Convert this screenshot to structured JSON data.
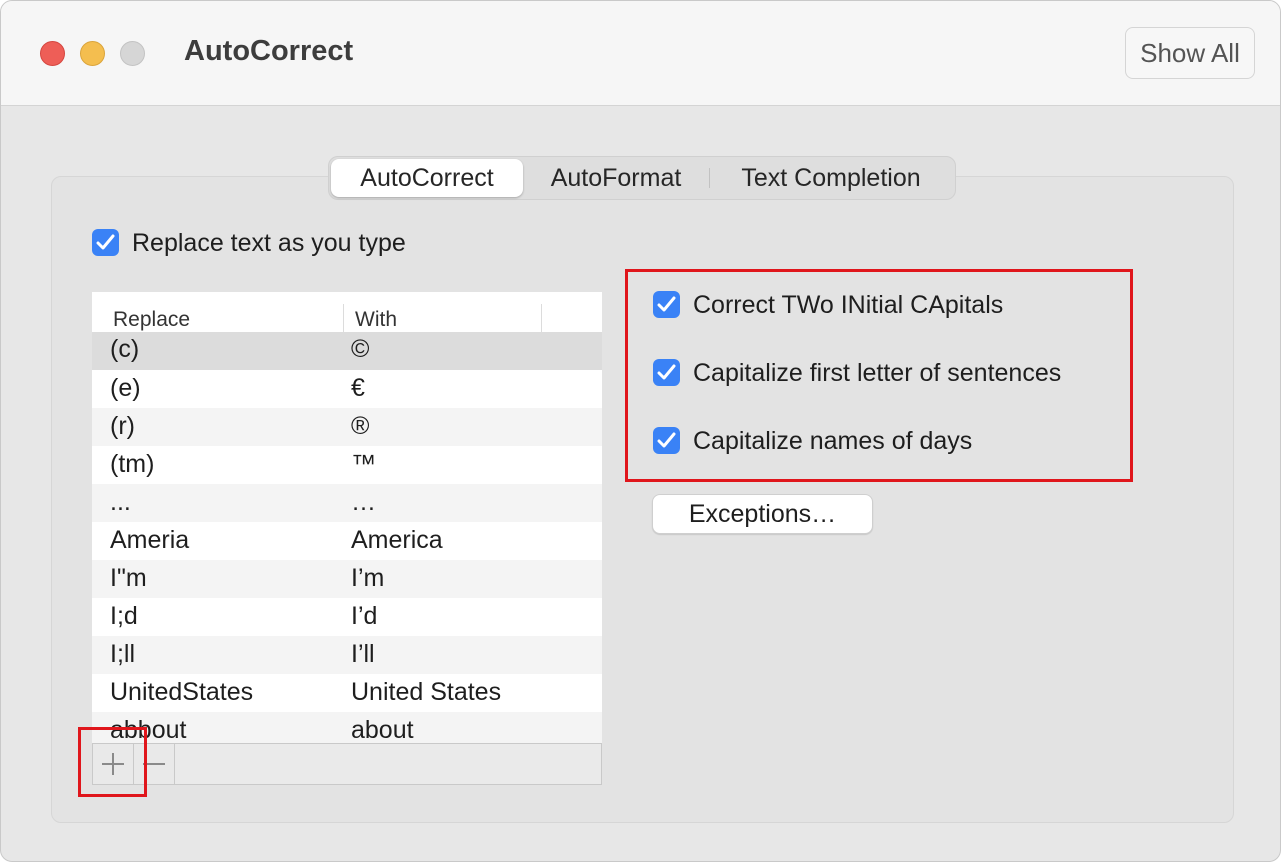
{
  "window": {
    "title": "AutoCorrect",
    "show_all_label": "Show All"
  },
  "tabs": [
    {
      "label": "AutoCorrect",
      "selected": true
    },
    {
      "label": "AutoFormat",
      "selected": false
    },
    {
      "label": "Text Completion",
      "selected": false
    }
  ],
  "replace_text": {
    "label": "Replace text as you type",
    "checked": true
  },
  "table": {
    "columns": [
      "Replace",
      "With"
    ],
    "rows": [
      {
        "replace": "(c)",
        "with": "©"
      },
      {
        "replace": "(e)",
        "with": "€"
      },
      {
        "replace": "(r)",
        "with": "®"
      },
      {
        "replace": "(tm)",
        "with": "™"
      },
      {
        "replace": "...",
        "with": "…"
      },
      {
        "replace": "Ameria",
        "with": "America"
      },
      {
        "replace": "I\"m",
        "with": "I’m"
      },
      {
        "replace": "I;d",
        "with": "I’d"
      },
      {
        "replace": "I;ll",
        "with": "I’ll"
      },
      {
        "replace": "UnitedStates",
        "with": "United States"
      },
      {
        "replace": "abbout",
        "with": "about"
      }
    ]
  },
  "options": [
    {
      "label": "Correct TWo INitial CApitals",
      "checked": true
    },
    {
      "label": "Capitalize first letter of sentences",
      "checked": true
    },
    {
      "label": "Capitalize names of days",
      "checked": true
    }
  ],
  "exceptions_label": "Exceptions…",
  "colors": {
    "accent": "#3a82f6",
    "highlight": "#e0161c"
  },
  "icons": {
    "add": "plus-icon",
    "remove": "minus-icon",
    "check": "checkmark-icon"
  }
}
